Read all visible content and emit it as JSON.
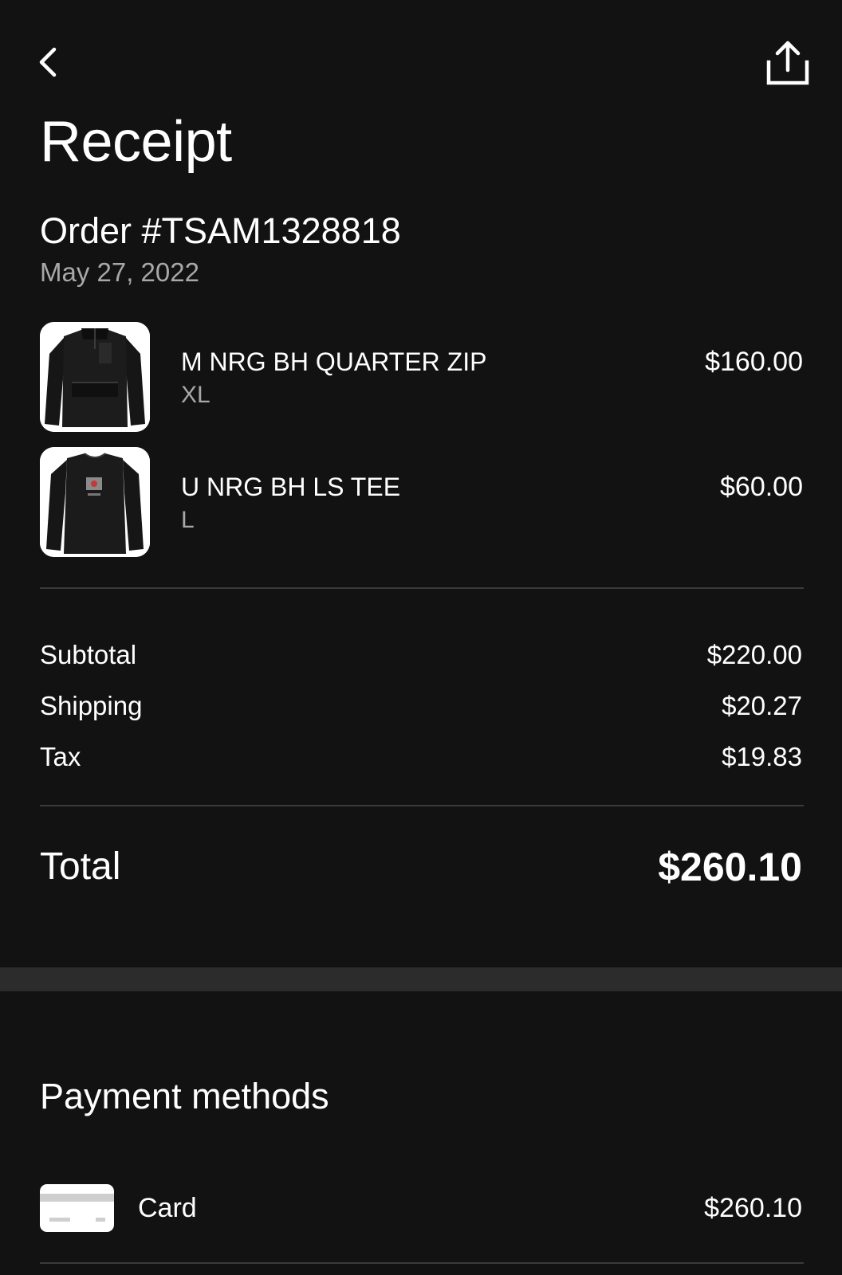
{
  "header": {
    "back_icon": "chevron-left-icon",
    "share_icon": "share-upload-icon",
    "title": "Receipt"
  },
  "order": {
    "number": "Order #TSAM1328818",
    "date": "May 27, 2022"
  },
  "items": [
    {
      "name": "M NRG BH QUARTER ZIP",
      "size": "XL",
      "price": "$160.00",
      "thumbnail_icon": "quarter-zip-jacket-image"
    },
    {
      "name": "U NRG BH LS TEE",
      "size": "L",
      "price": "$60.00",
      "thumbnail_icon": "long-sleeve-tee-image"
    }
  ],
  "summary": {
    "subtotal_label": "Subtotal",
    "subtotal_value": "$220.00",
    "shipping_label": "Shipping",
    "shipping_value": "$20.27",
    "tax_label": "Tax",
    "tax_value": "$19.83",
    "total_label": "Total",
    "total_value": "$260.10"
  },
  "payment": {
    "heading": "Payment methods",
    "methods": [
      {
        "label": "Card",
        "amount": "$260.10",
        "icon": "credit-card-icon"
      }
    ]
  },
  "colors": {
    "background": "#121212",
    "text_primary": "#ffffff",
    "text_secondary": "#a8a8a8",
    "divider": "#3a3a3a",
    "section_band": "#2c2c2c"
  }
}
